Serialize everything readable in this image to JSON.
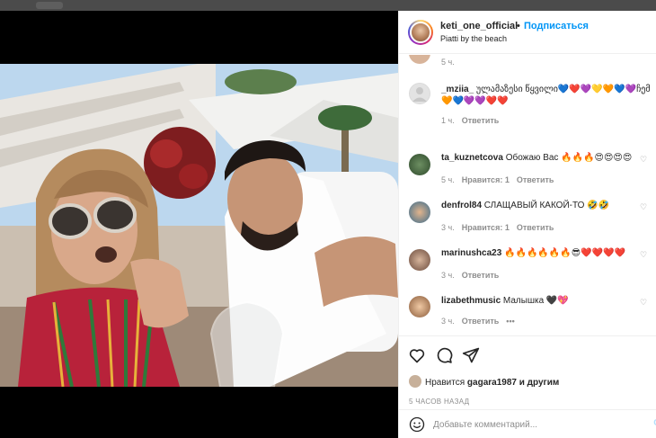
{
  "post": {
    "username": "keti_one_official",
    "separator": "•",
    "follow_label": "Подписаться",
    "location": "Piatti by the beach"
  },
  "comments": [
    {
      "user": "",
      "text": "",
      "time": "5 ч.",
      "likes": "",
      "reply": ""
    },
    {
      "user": "_mziia_",
      "text": "ულამაზესი წყვილი💙❤️💜💛🧡💙💜ჩემო ძვი",
      "text2": "🧡💙💜💜❤️❤️",
      "time": "1 ч.",
      "likes": "",
      "reply": "Ответить"
    },
    {
      "user": "ta_kuznetcova",
      "text": "Обожаю Вас 🔥🔥🔥😍😍😍😍",
      "time": "5 ч.",
      "likes": "Нравится: 1",
      "reply": "Ответить"
    },
    {
      "user": "denfrol84",
      "text": "СЛАЩАВЫЙ КАКОЙ-ТО 🤣🤣",
      "time": "3 ч.",
      "likes": "Нравится: 1",
      "reply": "Ответить"
    },
    {
      "user": "marinushca23",
      "text": "🔥🔥🔥🔥🔥🔥😎❤️❤️❤️❤️",
      "time": "3 ч.",
      "likes": "",
      "reply": "Ответить"
    },
    {
      "user": "lizabethmusic",
      "text": "Малышка 🖤💖",
      "time": "3 ч.",
      "likes": "",
      "reply": "Ответить",
      "more": "•••"
    }
  ],
  "likes_line": {
    "prefix": "Нравится",
    "user": "gagara1987",
    "suffix": "и другим"
  },
  "time_ago": "5 ЧАСОВ НАЗАД",
  "comment_box": {
    "placeholder": "Добавьте комментарий...",
    "publish": "О"
  },
  "icons": [
    "heart-icon",
    "comment-icon",
    "share-icon",
    "emoji-icon"
  ],
  "colors": {
    "follow": "#0095f6",
    "muted": "#8e8e8e",
    "backdrop": "#595959"
  }
}
